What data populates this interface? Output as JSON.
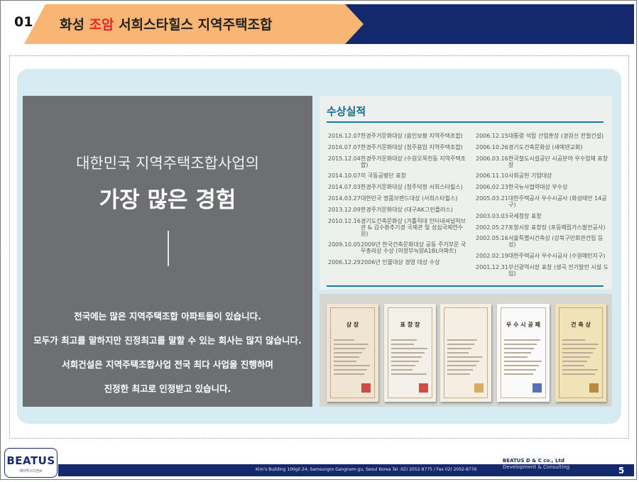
{
  "header": {
    "number": "01",
    "title_pre": "화성 ",
    "title_highlight": "조암",
    "title_post": " 서희스타힐스 지역주택조합"
  },
  "intro": {
    "line1": "대한민국 지역주택조합사업의",
    "line2": "가장 많은 경험",
    "paragraph": [
      "전국에는 많은 지역주택조합 아파트들이 있습니다.",
      "모두가 최고를 말하지만 진정최고를 말할 수 있는 회사는 많지 않습니다.",
      "서희건설은 지역주택조합사업 전국 최다 사업을 진행하며",
      "진정한 최고로 인정받고 있습니다."
    ]
  },
  "awards": {
    "title": "수상실적",
    "left": [
      {
        "date": "2016.12.07",
        "text": "한경주거문화대상 (용인보평 지역주택조합)"
      },
      {
        "date": "2016.07.07",
        "text": "한경주거문화대상 (청주용암 지역주택조합)"
      },
      {
        "date": "2015.12.04",
        "text": "한경주거문화대상 (수원오목천동 지역주택조합)"
      },
      {
        "date": "2014.10.07",
        "text": "미 국동공병단 표창"
      },
      {
        "date": "2014.07.03",
        "text": "한경주거문화대상 (청주덕정 서희스타힐스)"
      },
      {
        "date": "2014.03.27",
        "text": "대한민국 명품브랜드대상 (서희스타힐스)"
      },
      {
        "date": "2013.12.09",
        "text": "한경주거문화대상 (대구AK그린플러스)"
      },
      {
        "date": "2010.12.16",
        "text": "경기도건축문화상 (가톨릭대 인터내셔널허브관 & 김수환추기경 국제관 및 성심국제연수원)"
      },
      {
        "date": "2009.10.05",
        "text": "2009년 한국건축문화대상 공동 주거부문 국무총리상 수상 (의정부녹양A1BL아파트)"
      },
      {
        "date": "2006.12.29",
        "text": "2006년 인물대상 경영 대상 수상"
      }
    ],
    "right": [
      {
        "date": "2006.12.15",
        "text": "대통령 석탑 산업훈장 (경원선 전철건설)"
      },
      {
        "date": "2006.10.26",
        "text": "경기도건축문화상 (새에덴교회)"
      },
      {
        "date": "2006.03.16",
        "text": "한국철도시설공단 시공분야 우수업체 표창장"
      },
      {
        "date": "2006.11.10",
        "text": "사회공헌 기업대상"
      },
      {
        "date": "2006.02.23",
        "text": "한국뉴사협력대상 우수상"
      },
      {
        "date": "2005.03.21",
        "text": "대한주택공사 우수시공사 (화성태안 14공구)"
      },
      {
        "date": "2003.03.03",
        "text": "국세청장 표창"
      },
      {
        "date": "2002.05.27",
        "text": "포항시장 표창장 (포동매립가스발전공사)"
      },
      {
        "date": "2002.05.16",
        "text": "서울특별시건축상 (강북구민회관건립 등성)"
      },
      {
        "date": "2002.02.19",
        "text": "대한주택공사 우수시공사 (수원매탄지구)"
      },
      {
        "date": "2001.12.31",
        "text": "부산광역시장 표창 (생곡 전기발전 시설 도입)"
      }
    ]
  },
  "certificates": [
    {
      "title": "상 장",
      "bg": "#efe5d2",
      "seal": "#c8302a"
    },
    {
      "title": "표 창 장",
      "bg": "#f3f0ea",
      "seal": "#c8302a"
    },
    {
      "title": "",
      "bg": "#f4efe2",
      "seal": "#d2a04a"
    },
    {
      "title": "우 수 시 공 패",
      "bg": "#fafafa",
      "seal": "#3b5aa8"
    },
    {
      "title": "건 축 상",
      "bg": "#efe3b8",
      "seal": "#b07a2a"
    }
  ],
  "footer": {
    "address": "Kim's Building 100gil 24, Samsungro Gangnam-gu, Seoul Korea   Tel :02) 2052-8775 /  Fax 02) 2052-8776",
    "company": "BEATUS D & C co., Ltd",
    "tagline": "Development & Consulting",
    "page": "5"
  },
  "logo": {
    "text": "BEATUS",
    "sub": "베아투스디앤씨"
  },
  "colors": {
    "accent_orange": "#f9b574",
    "navy": "#14286e",
    "highlight_red": "#e8262a",
    "panel_blue": "#d6ebf2",
    "award_title": "#156b8f"
  }
}
